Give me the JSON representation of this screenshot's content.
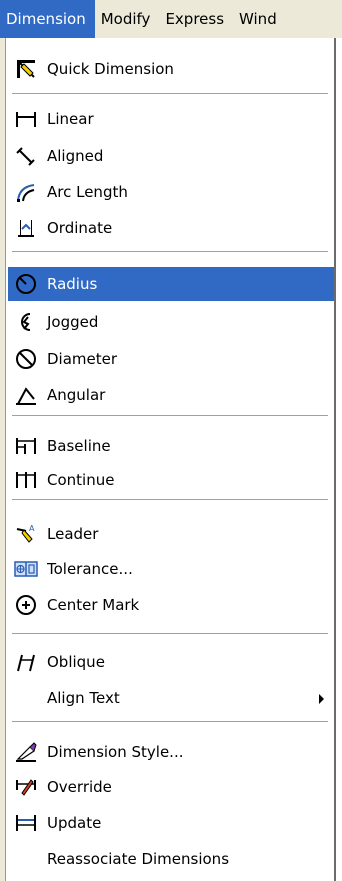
{
  "menubar": {
    "items": [
      "Dimension",
      "Modify",
      "Express",
      "Wind"
    ]
  },
  "dropdown": {
    "items": [
      {
        "label": "Quick Dimension",
        "icon": "quick-dimension-icon"
      },
      {
        "label": "Linear",
        "icon": "linear-icon"
      },
      {
        "label": "Aligned",
        "icon": "aligned-icon"
      },
      {
        "label": "Arc Length",
        "icon": "arc-length-icon"
      },
      {
        "label": "Ordinate",
        "icon": "ordinate-icon"
      },
      {
        "label": "Radius",
        "icon": "radius-icon",
        "highlighted": true
      },
      {
        "label": "Jogged",
        "icon": "jogged-icon"
      },
      {
        "label": "Diameter",
        "icon": "diameter-icon"
      },
      {
        "label": "Angular",
        "icon": "angular-icon"
      },
      {
        "label": "Baseline",
        "icon": "baseline-icon"
      },
      {
        "label": "Continue",
        "icon": "continue-icon"
      },
      {
        "label": "Leader",
        "icon": "leader-icon"
      },
      {
        "label": "Tolerance...",
        "icon": "tolerance-icon"
      },
      {
        "label": "Center Mark",
        "icon": "center-mark-icon"
      },
      {
        "label": "Oblique",
        "icon": "oblique-icon"
      },
      {
        "label": "Align Text",
        "submenu": true
      },
      {
        "label": "Dimension Style...",
        "icon": "dimension-style-icon"
      },
      {
        "label": "Override",
        "icon": "override-icon"
      },
      {
        "label": "Update",
        "icon": "update-icon"
      },
      {
        "label": "Reassociate Dimensions"
      }
    ]
  },
  "colors": {
    "highlight": "#316ac5",
    "menubar_bg": "#ece9d8"
  }
}
